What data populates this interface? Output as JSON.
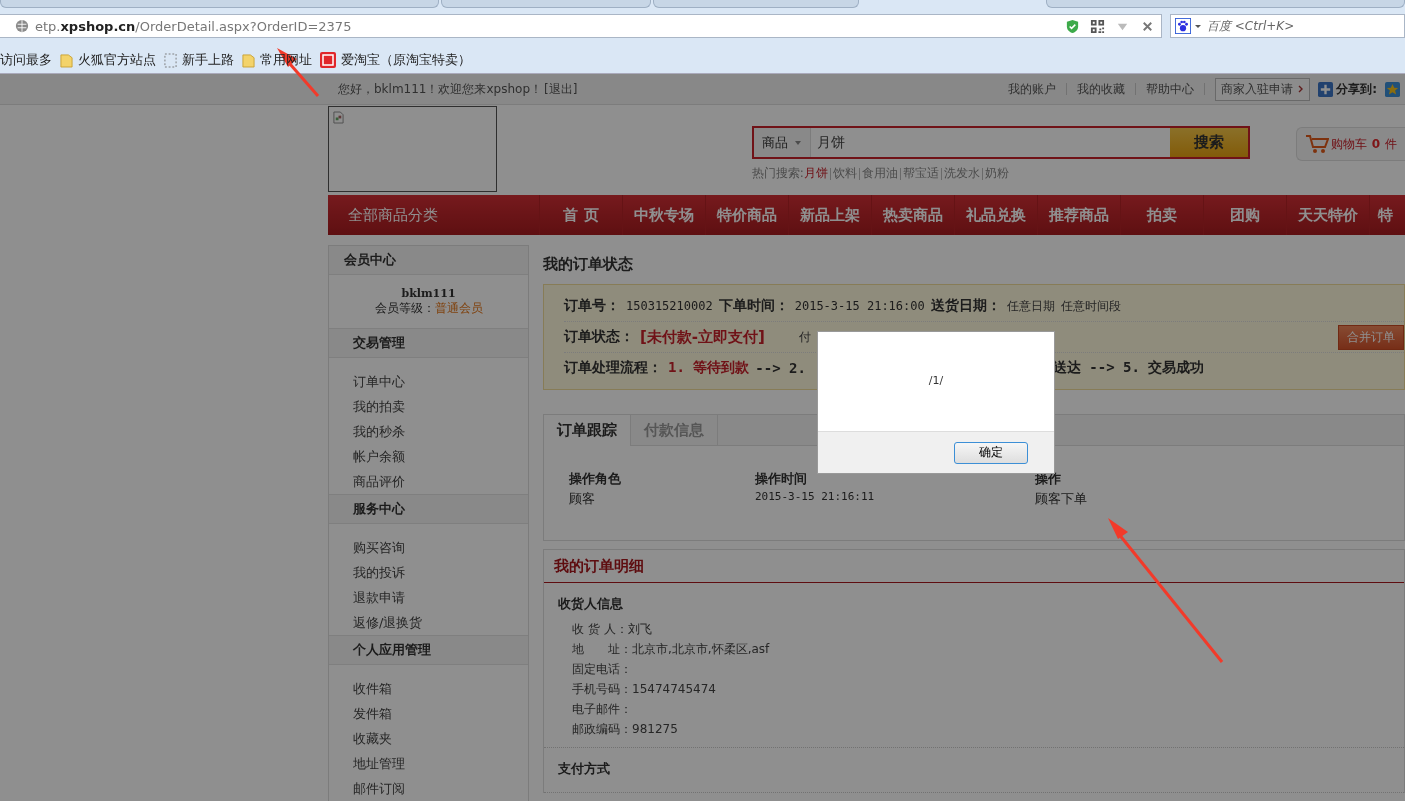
{
  "browser": {
    "url": "etp.**xpshop.cn**/OrderDetail.aspx?OrderID=2375",
    "search_placeholder": "百度 <Ctrl+K>",
    "bookmarks": [
      {
        "label": "访问最多",
        "kind": "none"
      },
      {
        "label": "火狐官方站点",
        "kind": "folder"
      },
      {
        "label": "新手上路",
        "kind": "page"
      },
      {
        "label": "常用网址",
        "kind": "folder"
      },
      {
        "label": "爱淘宝（原淘宝特卖）",
        "kind": "taobao"
      }
    ]
  },
  "topbar": {
    "greeting": "您好，bklm111！欢迎您来xpshop！",
    "logout": "[退出]",
    "links": [
      "我的账户",
      "我的收藏",
      "帮助中心"
    ],
    "merchant": "商家入驻申请",
    "share": "分享到:"
  },
  "search": {
    "category": "商品",
    "value": "月饼",
    "button": "搜索",
    "hot_label": "热门搜索:",
    "hot": [
      {
        "label": "月饼",
        "highlighted": true
      },
      {
        "label": "饮料",
        "highlighted": false
      },
      {
        "label": "食用油",
        "highlighted": false
      },
      {
        "label": "帮宝适",
        "highlighted": false
      },
      {
        "label": "洗发水",
        "highlighted": false
      },
      {
        "label": "奶粉",
        "highlighted": false
      }
    ]
  },
  "cart": {
    "label": "购物车",
    "count": "0",
    "suffix": "件"
  },
  "nav": {
    "category": "全部商品分类",
    "items": [
      "首 页",
      "中秋专场",
      "特价商品",
      "新品上架",
      "热卖商品",
      "礼品兑换",
      "推荐商品",
      "拍卖",
      "团购",
      "天天特价",
      "特"
    ]
  },
  "sidebar": {
    "title": "会员中心",
    "username": "bklm111",
    "level_label": "会员等级：",
    "level": "普通会员",
    "sections": [
      {
        "title": "交易管理",
        "items": [
          "订单中心",
          "我的拍卖",
          "我的秒杀",
          "帐户余额",
          "商品评价"
        ]
      },
      {
        "title": "服务中心",
        "items": [
          "购买咨询",
          "我的投诉",
          "退款申请",
          "返修/退换货"
        ]
      },
      {
        "title": "个人应用管理",
        "items": [
          "收件箱",
          "发件箱",
          "收藏夹",
          "地址管理",
          "邮件订阅"
        ]
      }
    ]
  },
  "order_status": {
    "title": "我的订单状态",
    "order_no_label": "订单号：",
    "order_no": "150315210002",
    "time_label": "下单时间：",
    "time": "2015-3-15 21:16:00",
    "delivery_label": "送货日期：",
    "delivery_values": [
      "任意日期",
      "任意时间段"
    ],
    "status_label": "订单状态：",
    "status": "[未付款-立即支付]",
    "status_after": "付",
    "merge_button": "合并订单",
    "flow_label": "订单处理流程：",
    "flow_current": "1. 等待到款",
    "flow_next": " --> 2.",
    "flow_rest": "送达 --> 5. 交易成功"
  },
  "tabs": [
    {
      "label": "订单跟踪",
      "selected": true
    },
    {
      "label": "付款信息",
      "selected": false
    }
  ],
  "tracking": {
    "columns": [
      "操作角色",
      "操作时间",
      "操作"
    ],
    "rows": [
      [
        "顾客",
        "2015-3-15 21:16:11",
        "顾客下单"
      ]
    ]
  },
  "detail": {
    "title": "我的订单明细",
    "consignee_title": "收货人信息",
    "fields": [
      {
        "label": "收 货 人：",
        "value": "刘飞"
      },
      {
        "label": "地　　址：",
        "value": "北京市,北京市,怀柔区,asf"
      },
      {
        "label": "固定电话："
      },
      {
        "label": "手机号码：",
        "value": "15474745474"
      },
      {
        "label": "电子邮件："
      },
      {
        "label": "邮政编码：",
        "value": "981275"
      }
    ],
    "payment_title": "支付方式"
  },
  "dialog": {
    "message": "/1/",
    "button": "确定"
  }
}
